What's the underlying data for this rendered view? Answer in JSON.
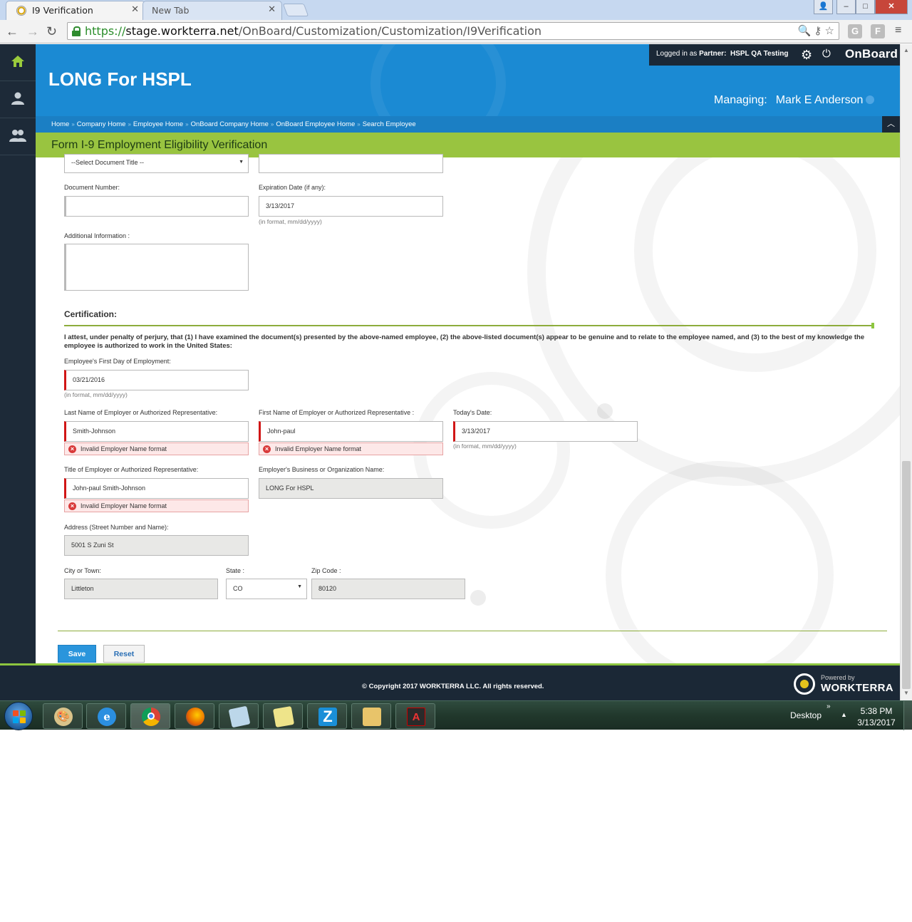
{
  "browser": {
    "tabs": [
      {
        "label": "I9 Verification"
      },
      {
        "label": "New Tab"
      }
    ],
    "url": {
      "scheme": "https://",
      "host": "stage.workterra.net",
      "path": "/OnBoard/Customization/Customization/I9Verification"
    },
    "win": {
      "minimize": "–",
      "maximize": "□",
      "close": "✕"
    }
  },
  "header": {
    "app_title": "LONG For HSPL",
    "logged_in_prefix": "Logged in as",
    "partner_label": "Partner:",
    "partner_name": "HSPL QA Testing",
    "brand": "OnBoard",
    "managing_label": "Managing:",
    "managing_name": "Mark E Anderson"
  },
  "breadcrumb": [
    "Home",
    "Company Home",
    "Employee Home",
    "OnBoard Company Home",
    "OnBoard Employee Home",
    "Search Employee"
  ],
  "page_title": "Form I-9 Employment Eligibility Verification",
  "form": {
    "document_title": {
      "value": "--Select Document Title --"
    },
    "document_number": {
      "label": "Document Number:",
      "value": ""
    },
    "expiration_date": {
      "label": "Expiration Date (if any):",
      "value": "3/13/2017",
      "hint": "(in format, mm/dd/yyyy)"
    },
    "additional_info": {
      "label": "Additional Information :",
      "value": ""
    },
    "certification": {
      "title": "Certification:",
      "attest": "I attest, under penalty of perjury, that (1) I have examined the document(s) presented by the above-named employee, (2) the above-listed document(s) appear to be genuine and to relate to the employee named, and (3) to the best of my knowledge the employee is authorized to work in the United States:"
    },
    "first_day": {
      "label": "Employee's First Day of Employment:",
      "value": "03/21/2016",
      "hint": "(in format, mm/dd/yyyy)"
    },
    "employer_last_name": {
      "label": "Last Name of Employer or Authorized Representative:",
      "value": "Smith-Johnson",
      "error": "Invalid Employer Name format"
    },
    "employer_first_name": {
      "label": "First Name of Employer or Authorized Representative :",
      "value": "John-paul",
      "error": "Invalid Employer Name format"
    },
    "todays_date": {
      "label": "Today's Date:",
      "value": "3/13/2017",
      "hint": "(in format, mm/dd/yyyy)"
    },
    "employer_title": {
      "label": "Title of Employer or Authorized Representative:",
      "value": "John-paul Smith-Johnson",
      "error": "Invalid Employer Name format"
    },
    "business_name": {
      "label": "Employer's Business or Organization Name:",
      "value": "LONG For HSPL"
    },
    "address": {
      "label": "Address (Street Number and Name):",
      "value": "5001 S Zuni St"
    },
    "city": {
      "label": "City or Town:",
      "value": "Littleton"
    },
    "state": {
      "label": "State :",
      "value": "CO"
    },
    "zip": {
      "label": "Zip Code :",
      "value": "80120"
    },
    "save_label": "Save",
    "reset_label": "Reset"
  },
  "footer": {
    "copyright": "© Copyright 2017 WORKTERRA LLC. All rights reserved.",
    "powered_by": "Powered by",
    "brand": "WORKTERRA"
  },
  "taskbar": {
    "desktop_label": "Desktop",
    "tray_chevron": "»",
    "tray_up": "▲",
    "time": "5:38 PM",
    "date": "3/13/2017",
    "apps": [
      "paint-icon",
      "internet-explorer-icon",
      "chrome-icon",
      "firefox-icon",
      "notepad-icon",
      "sticky-notes-icon",
      "z-app-icon",
      "file-explorer-icon",
      "acrobat-icon"
    ]
  },
  "colors": {
    "header_blue": "#1b8ad3",
    "dark_navy": "#1b2836",
    "green_bar": "#99c440",
    "error_red": "#d11616"
  }
}
